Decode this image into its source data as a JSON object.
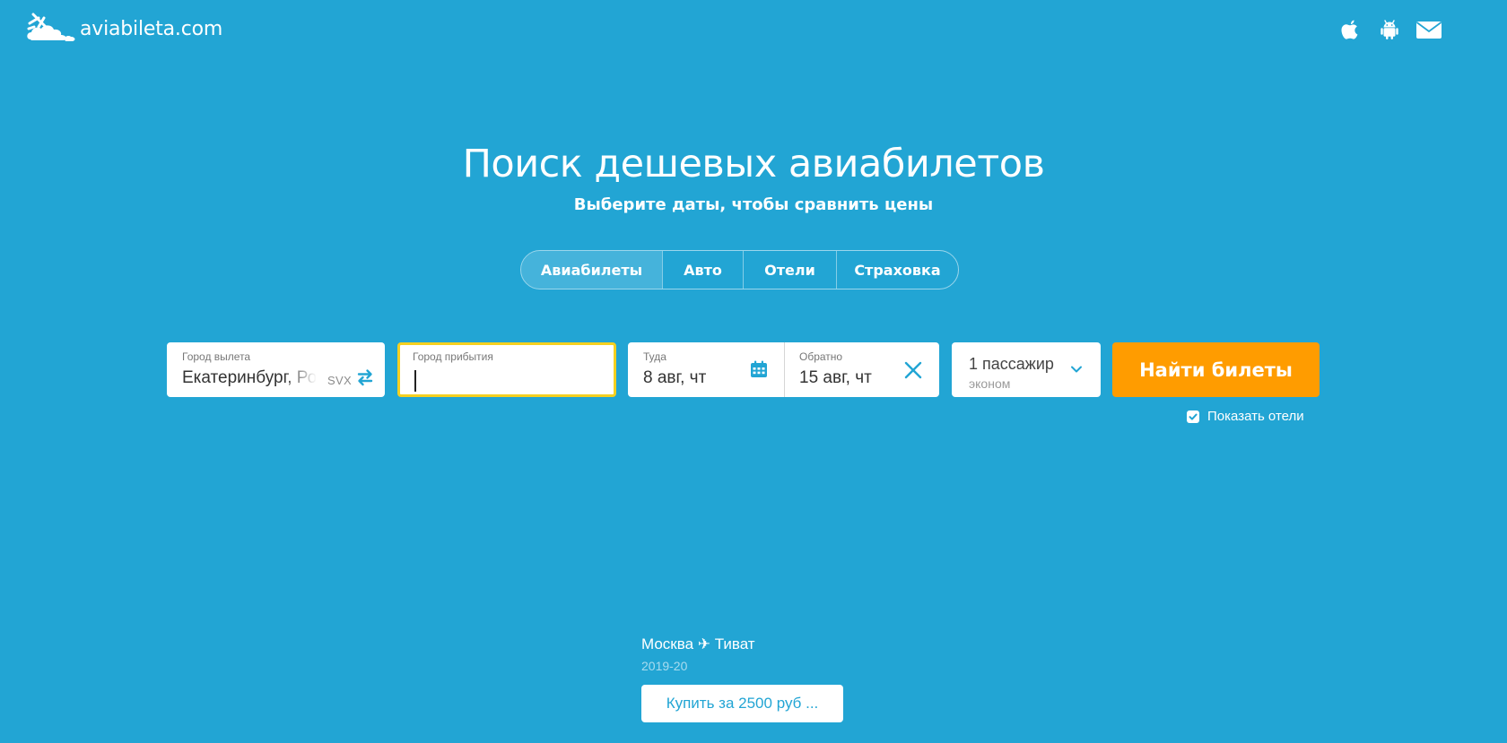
{
  "header": {
    "logo_text": "aviabileta.com",
    "icons": [
      "apple-icon",
      "android-icon",
      "mail-icon"
    ]
  },
  "hero": {
    "title": "Поиск дешевых авиабилетов",
    "subtitle": "Выберите даты, чтобы сравнить цены"
  },
  "tabs": [
    {
      "label": "Авиабилеты",
      "active": true
    },
    {
      "label": "Авто",
      "active": false
    },
    {
      "label": "Отели",
      "active": false
    },
    {
      "label": "Страховка",
      "active": false
    }
  ],
  "search": {
    "origin": {
      "label": "Город вылета",
      "value": "Екатеринбург, Россия",
      "iata": "SVX"
    },
    "destination": {
      "label": "Город прибытия",
      "value": "",
      "focused": true
    },
    "depart": {
      "label": "Туда",
      "value": "8 авг, чт"
    },
    "return": {
      "label": "Обратно",
      "value": "15 авг, чт"
    },
    "passengers": {
      "count_label": "1 пассажир",
      "class_label": "эконом"
    },
    "submit_label": "Найти билеты",
    "show_hotels": {
      "label": "Показать отели",
      "checked": true
    }
  },
  "promo": {
    "route": "Москва ✈ Тиват",
    "year": "2019-20",
    "button_label": "Купить за 2500 руб ..."
  },
  "colors": {
    "background": "#22a5d4",
    "accent_orange": "#ff9c00",
    "focus_yellow": "#f5d020",
    "icon_blue": "#22a5d4"
  }
}
